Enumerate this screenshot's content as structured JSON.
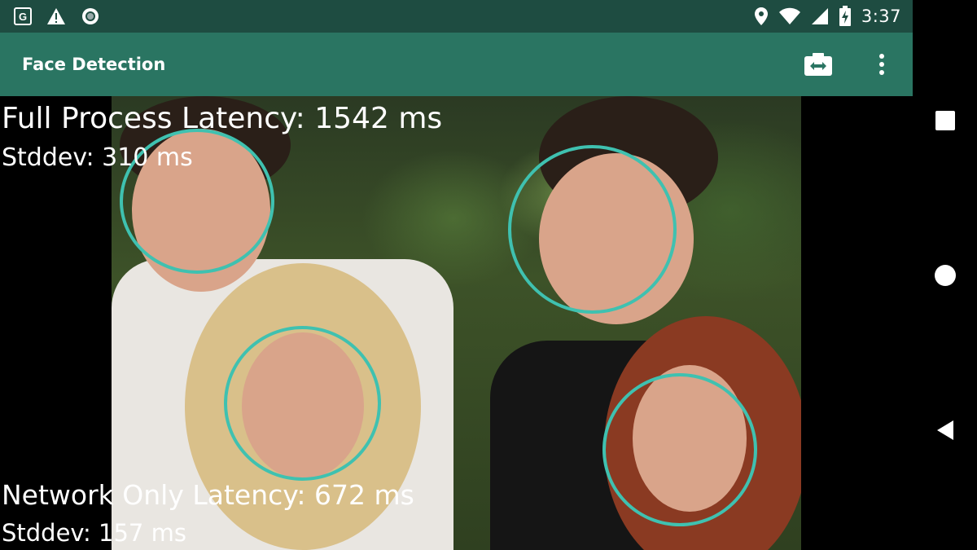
{
  "status_bar": {
    "time": "3:37",
    "left_icons": [
      "google-icon",
      "warning-icon",
      "sync-icon"
    ],
    "right_icons": [
      "location-icon",
      "wifi-icon",
      "signal-icon",
      "battery-charging-icon"
    ]
  },
  "app_bar": {
    "title": "Face Detection",
    "actions": [
      "switch-camera-icon",
      "more-vert-icon"
    ]
  },
  "stats": {
    "full_process_latency": "Full Process Latency: 1542 ms",
    "full_process_stddev": "Stddev: 310 ms",
    "network_only_latency": "Network Only Latency: 672 ms",
    "network_only_stddev": "Stddev: 157 ms"
  },
  "detections": {
    "count": 4,
    "circle_color": "#3fc1b0"
  },
  "nav_bar": {
    "buttons": [
      "recents-icon",
      "home-icon",
      "back-icon"
    ]
  },
  "colors": {
    "status_bar": "#1e4c41",
    "app_bar": "#2a7562",
    "background": "#000000"
  }
}
